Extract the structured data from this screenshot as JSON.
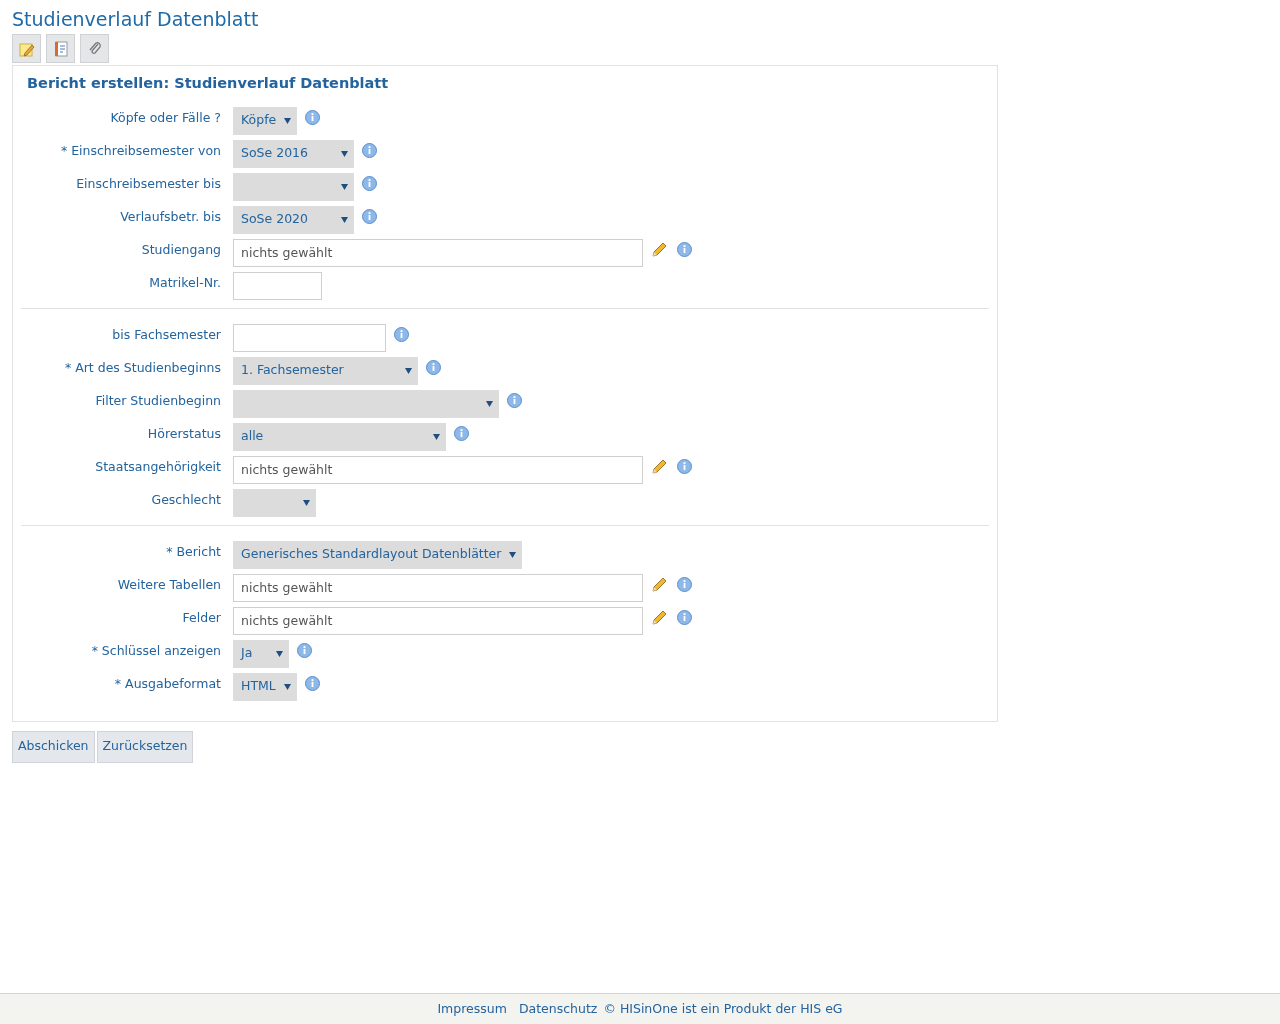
{
  "page_title": "Studienverlauf Datenblatt",
  "toolbar": [
    {
      "kind": "note"
    },
    {
      "kind": "notebook"
    },
    {
      "kind": "paperclip"
    }
  ],
  "form": {
    "title": "Bericht erstellen: Studienverlauf Datenblatt",
    "sections": [
      {
        "fields": [
          {
            "label": "Köpfe oder Fälle ?",
            "kind": "select",
            "value": "Köpfe",
            "info": true
          },
          {
            "label": "* Einschreibsemester von",
            "kind": "select",
            "value": "SoSe 2016",
            "info": true
          },
          {
            "label": "Einschreibsemester bis",
            "kind": "select",
            "info": true
          },
          {
            "label": "Verlaufsbetr. bis",
            "kind": "select",
            "value": "SoSe 2020",
            "info": true
          },
          {
            "label": "Studiengang",
            "kind": "picker",
            "value": "nichts gewählt",
            "info": true
          },
          {
            "label": "Matrikel-Nr.",
            "kind": "input",
            "info": false
          }
        ]
      },
      {
        "fields": [
          {
            "label": "bis Fachsemester",
            "kind": "input",
            "info": true
          },
          {
            "label": "* Art des Studienbeginns",
            "kind": "select",
            "value": "1. Fachsemester",
            "info": true
          },
          {
            "label": "Filter Studienbeginn",
            "kind": "select",
            "info": true
          },
          {
            "label": "Hörerstatus",
            "kind": "select",
            "value": "alle",
            "info": true
          },
          {
            "label": "Staatsangehörigkeit",
            "kind": "picker",
            "value": "nichts gewählt",
            "info": true
          },
          {
            "label": "Geschlecht",
            "kind": "select",
            "info": false
          }
        ]
      },
      {
        "fields": [
          {
            "label": "* Bericht",
            "kind": "select",
            "value": "Generisches Standardlayout Datenblätter",
            "info": false
          },
          {
            "label": "Weitere Tabellen",
            "kind": "picker",
            "value": "nichts gewählt",
            "info": true
          },
          {
            "label": "Felder",
            "kind": "picker",
            "value": "nichts gewählt",
            "info": true
          },
          {
            "label": "* Schlüssel anzeigen",
            "kind": "select",
            "value": "Ja",
            "info": true
          },
          {
            "label": "* Ausgabeformat",
            "kind": "select",
            "value": "HTML",
            "info": true
          }
        ]
      }
    ]
  },
  "buttons": [
    "Abschicken",
    "Zurücksetzen"
  ],
  "footer": {
    "links": [
      "Impressum",
      "Datenschutz"
    ],
    "text": "© HISinOne ist ein Produkt der HIS eG"
  }
}
